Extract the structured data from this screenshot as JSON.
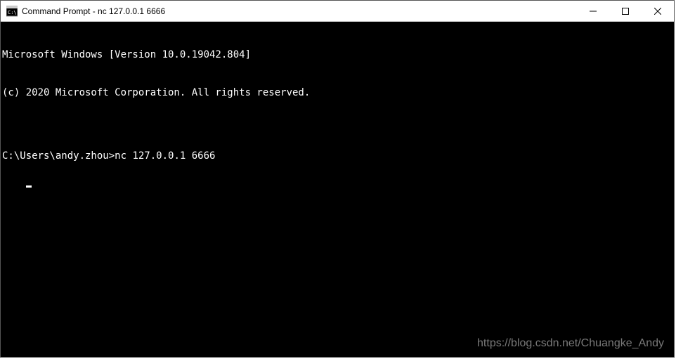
{
  "window": {
    "title": "Command Prompt - nc  127.0.0.1 6666"
  },
  "terminal": {
    "line1": "Microsoft Windows [Version 10.0.19042.804]",
    "line2": "(c) 2020 Microsoft Corporation. All rights reserved.",
    "blank": "",
    "prompt": "C:\\Users\\andy.zhou>",
    "command": "nc 127.0.0.1 6666"
  },
  "watermark": "https://blog.csdn.net/Chuangke_Andy"
}
